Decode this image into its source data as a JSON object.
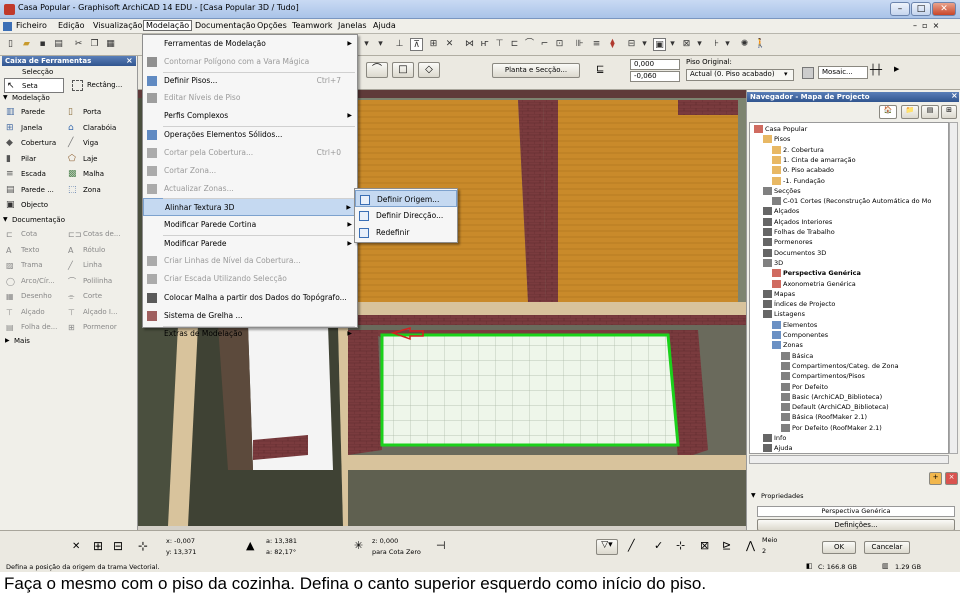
{
  "window": {
    "title": "Casa Popular - Graphisoft ArchiCAD 14 EDU - [Casa Popular 3D / Tudo]",
    "min": "–",
    "max": "□",
    "close": "✕"
  },
  "menubar": [
    "Ficheiro",
    "Edição",
    "Visualização",
    "Modelação",
    "Documentação",
    "Opções",
    "Teamwork",
    "Janelas",
    "Ajuda"
  ],
  "menu": {
    "items": [
      {
        "label": "Ferramentas de Modelação",
        "shortcut": "",
        "arrow": "▶",
        "disabled": false
      },
      {
        "label": "Contornar Polígono com a Vara Mágica",
        "shortcut": "",
        "arrow": "",
        "disabled": true
      },
      {
        "label": "Definir Pisos...",
        "shortcut": "Ctrl+7",
        "arrow": "",
        "disabled": false
      },
      {
        "label": "Editar Níveis de Piso",
        "shortcut": "",
        "arrow": "",
        "disabled": true
      },
      {
        "label": "Perfis Complexos",
        "shortcut": "",
        "arrow": "▶",
        "disabled": false
      },
      {
        "label": "Operações Elementos Sólidos...",
        "shortcut": "",
        "arrow": "",
        "disabled": false
      },
      {
        "label": "Cortar pela Cobertura...",
        "shortcut": "Ctrl+0",
        "arrow": "",
        "disabled": true
      },
      {
        "label": "Cortar Zona...",
        "shortcut": "",
        "arrow": "",
        "disabled": true
      },
      {
        "label": "Actualizar Zonas...",
        "shortcut": "",
        "arrow": "",
        "disabled": true
      },
      {
        "label": "Alinhar Textura 3D",
        "shortcut": "",
        "arrow": "▶",
        "disabled": false
      },
      {
        "label": "Modificar Parede Cortina",
        "shortcut": "",
        "arrow": "▶",
        "disabled": false
      },
      {
        "label": "Modificar Parede",
        "shortcut": "",
        "arrow": "▶",
        "disabled": false
      },
      {
        "label": "Criar Linhas de Nível da Cobertura...",
        "shortcut": "",
        "arrow": "",
        "disabled": true
      },
      {
        "label": "Criar Escada Utilizando Selecção",
        "shortcut": "",
        "arrow": "",
        "disabled": true
      },
      {
        "label": "Colocar Malha a partir dos Dados do Topógrafo...",
        "shortcut": "",
        "arrow": "",
        "disabled": false
      },
      {
        "label": "Sistema de Grelha ...",
        "shortcut": "",
        "arrow": "",
        "disabled": false
      },
      {
        "label": "Extras de Modelação",
        "shortcut": "",
        "arrow": "▶",
        "disabled": false
      }
    ]
  },
  "submenu": {
    "items": [
      "Definir Origem...",
      "Definir Direcção...",
      "Redefinir"
    ]
  },
  "toolbox": {
    "title": "Caixa de Ferramentas",
    "selection_header": "Selecção",
    "seta": "Seta",
    "rect": "Rectâng...",
    "modelacao_header": "Modelação",
    "model_tools": [
      "Parede",
      "Porta",
      "Janela",
      "Clarabóia",
      "Cobertura",
      "Viga",
      "Pilar",
      "Laje",
      "Escada",
      "Malha",
      "Parede ...",
      "Zona",
      "Objecto"
    ],
    "documentacao_header": "Documentação",
    "doc_tools": [
      "Cota",
      "Cotas de...",
      "Texto",
      "Rótulo",
      "Trama",
      "Linha",
      "Arco/Cír...",
      "Polilinha",
      "Desenho",
      "Corte",
      "Alçado",
      "Alçado I...",
      "Folha de...",
      "Pormenor"
    ],
    "mais": "Mais"
  },
  "infobox": {
    "planta_btn": "Planta e Secção...",
    "val1": "0,000",
    "val2": "-0,060",
    "piso_label": "Piso Original:",
    "piso_value": "Actual (0. Piso acabado)",
    "mosaic": "Mosaic..."
  },
  "navigator": {
    "title": "Navegador - Mapa de Projecto",
    "tree": [
      {
        "label": "Casa Popular",
        "level": 0,
        "bold": false
      },
      {
        "label": "Pisos",
        "level": 1,
        "bold": false
      },
      {
        "label": "2. Cobertura",
        "level": 2,
        "bold": false
      },
      {
        "label": "1. Cinta de amarração",
        "level": 2,
        "bold": false
      },
      {
        "label": "0. Piso acabado",
        "level": 2,
        "bold": false
      },
      {
        "label": "-1. Fundação",
        "level": 2,
        "bold": false
      },
      {
        "label": "Secções",
        "level": 1,
        "bold": false
      },
      {
        "label": "C-01 Cortes (Reconstrução Automática do Mo",
        "level": 2,
        "bold": false
      },
      {
        "label": "Alçados",
        "level": 1,
        "bold": false
      },
      {
        "label": "Alçados Interiores",
        "level": 1,
        "bold": false
      },
      {
        "label": "Folhas de Trabalho",
        "level": 1,
        "bold": false
      },
      {
        "label": "Pormenores",
        "level": 1,
        "bold": false
      },
      {
        "label": "Documentos 3D",
        "level": 1,
        "bold": false
      },
      {
        "label": "3D",
        "level": 1,
        "bold": false
      },
      {
        "label": "Perspectiva Genérica",
        "level": 2,
        "bold": true
      },
      {
        "label": "Axonometria Genérica",
        "level": 2,
        "bold": false
      },
      {
        "label": "Mapas",
        "level": 1,
        "bold": false
      },
      {
        "label": "Índices de Projecto",
        "level": 1,
        "bold": false
      },
      {
        "label": "Listagens",
        "level": 1,
        "bold": false
      },
      {
        "label": "Elementos",
        "level": 2,
        "bold": false
      },
      {
        "label": "Componentes",
        "level": 2,
        "bold": false
      },
      {
        "label": "Zonas",
        "level": 2,
        "bold": false
      },
      {
        "label": "Básica",
        "level": 3,
        "bold": false
      },
      {
        "label": "Compartimentos/Categ. de Zona",
        "level": 3,
        "bold": false
      },
      {
        "label": "Compartimentos/Pisos",
        "level": 3,
        "bold": false
      },
      {
        "label": "Por Defeito",
        "level": 3,
        "bold": false
      },
      {
        "label": "Basic (ArchiCAD_Biblioteca)",
        "level": 3,
        "bold": false
      },
      {
        "label": "Default (ArchiCAD_Biblioteca)",
        "level": 3,
        "bold": false
      },
      {
        "label": "Básica (RoofMaker 2.1)",
        "level": 3,
        "bold": false
      },
      {
        "label": "Por Defeito (RoofMaker 2.1)",
        "level": 3,
        "bold": false
      },
      {
        "label": "Info",
        "level": 1,
        "bold": false
      },
      {
        "label": "Ajuda",
        "level": 1,
        "bold": false
      }
    ],
    "props_header": "Propriedades",
    "props_value": "Perspectiva Genérica",
    "definicoes": "Definições..."
  },
  "status": {
    "message": "Defina a posição da origem da trama Vectorial.",
    "x": "x: -0,007",
    "y": "y: 13,371",
    "a": "a: 13,381",
    "ang": "a: 82,17°",
    "z": "z: 0,000",
    "cota": "para Cota Zero",
    "meio_label": "Meio",
    "meio_value": "2",
    "ok": "OK",
    "cancelar": "Cancelar",
    "disk": "C: 166.8 GB",
    "mem": "1.29 GB"
  },
  "caption": "Faça o mesmo com o piso da cozinha. Defina o canto superior esquerdo como início do piso."
}
